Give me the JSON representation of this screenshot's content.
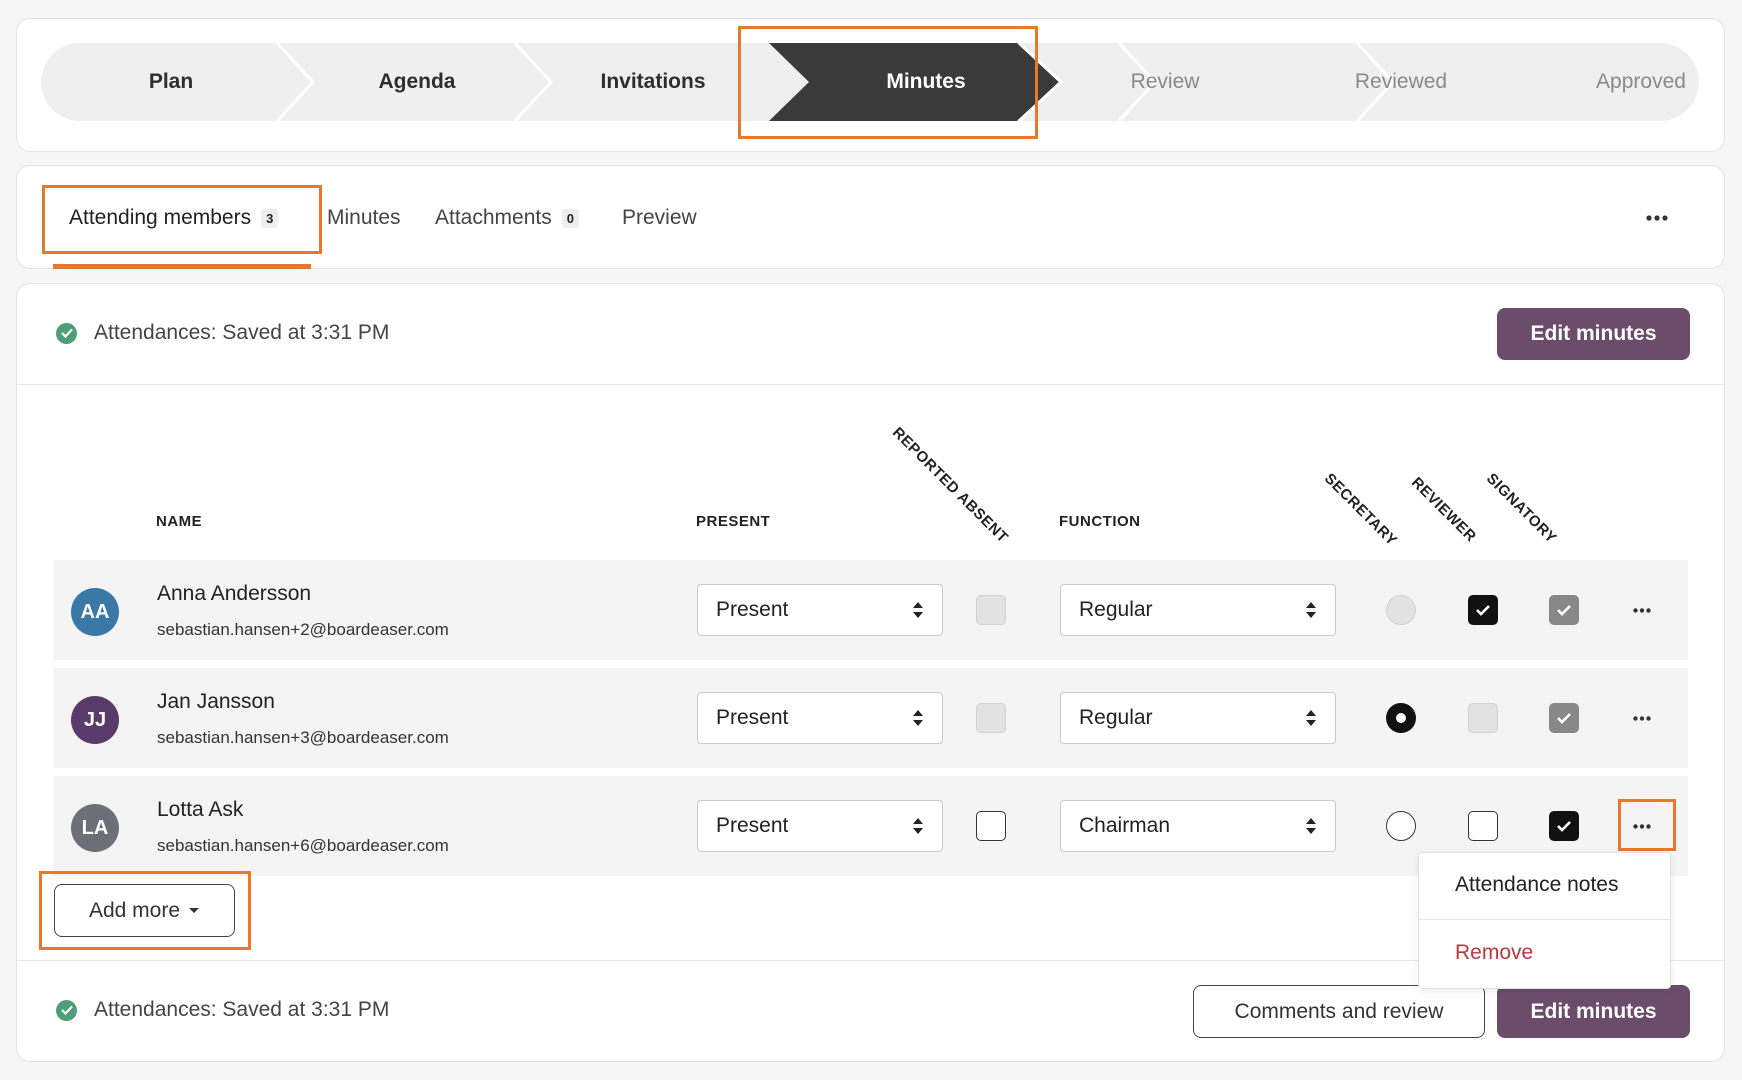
{
  "stepper": {
    "steps": [
      {
        "label": "Plan",
        "state": "done"
      },
      {
        "label": "Agenda",
        "state": "done"
      },
      {
        "label": "Invitations",
        "state": "done"
      },
      {
        "label": "Minutes",
        "state": "active"
      },
      {
        "label": "Review",
        "state": "todo"
      },
      {
        "label": "Reviewed",
        "state": "todo"
      },
      {
        "label": "Approved",
        "state": "todo"
      }
    ]
  },
  "tabs": {
    "items": [
      {
        "label": "Attending members",
        "badge": "3"
      },
      {
        "label": "Minutes"
      },
      {
        "label": "Attachments",
        "badge": "0"
      },
      {
        "label": "Preview"
      }
    ],
    "overflow_icon": "ellipsis-icon"
  },
  "status": {
    "top_text": "Attendances: Saved at 3:31 PM",
    "bottom_text": "Attendances: Saved at 3:31 PM"
  },
  "actions": {
    "edit_minutes": "Edit minutes",
    "add_more": "Add more",
    "comments_review": "Comments and review"
  },
  "table": {
    "headers": {
      "name": "NAME",
      "present": "PRESENT",
      "reported_absent": "REPORTED ABSENT",
      "function": "FUNCTION",
      "secretary": "SECRETARY",
      "reviewer": "REVIEWER",
      "signatory": "SIGNATORY"
    },
    "rows": [
      {
        "initials": "AA",
        "name": "Anna Andersson",
        "email": "sebastian.hansen+2@boardeaser.com",
        "present": "Present",
        "function": "Regular",
        "avatar_color": "#3a78a8"
      },
      {
        "initials": "JJ",
        "name": "Jan Jansson",
        "email": "sebastian.hansen+3@boardeaser.com",
        "present": "Present",
        "function": "Regular",
        "avatar_color": "#5a3a6a"
      },
      {
        "initials": "LA",
        "name": "Lotta Ask",
        "email": "sebastian.hansen+6@boardeaser.com",
        "present": "Present",
        "function": "Chairman",
        "avatar_color": "#6e6e78"
      }
    ]
  },
  "row_menu": {
    "items": [
      {
        "label": "Attendance notes",
        "color": "#222222"
      },
      {
        "label": "Remove",
        "color": "#b8393f"
      }
    ]
  },
  "colors": {
    "accent": "#6b4d6b",
    "highlight": "#e8782e",
    "active_step": "#3a3a3a",
    "success": "#4e9e78"
  }
}
